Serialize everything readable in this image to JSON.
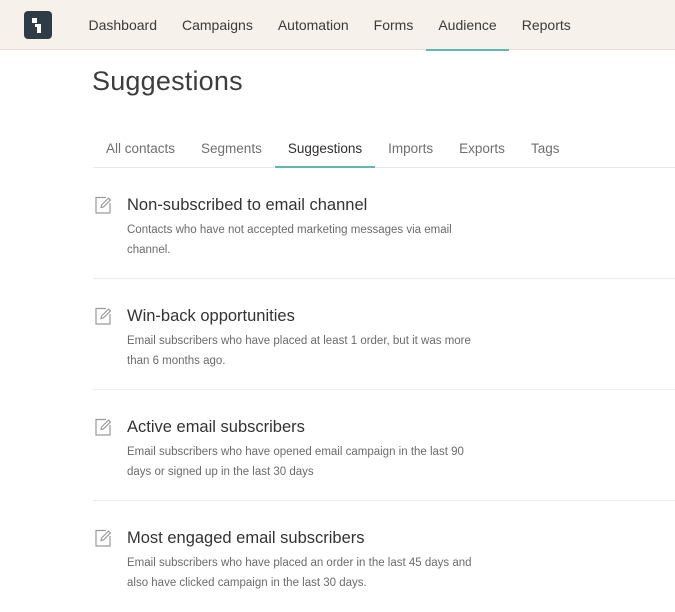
{
  "nav": {
    "items": [
      {
        "label": "Dashboard",
        "active": false
      },
      {
        "label": "Campaigns",
        "active": false
      },
      {
        "label": "Automation",
        "active": false
      },
      {
        "label": "Forms",
        "active": false
      },
      {
        "label": "Audience",
        "active": true
      },
      {
        "label": "Reports",
        "active": false
      }
    ]
  },
  "page": {
    "title": "Suggestions"
  },
  "tabs": [
    {
      "label": "All contacts",
      "active": false
    },
    {
      "label": "Segments",
      "active": false
    },
    {
      "label": "Suggestions",
      "active": true
    },
    {
      "label": "Imports",
      "active": false
    },
    {
      "label": "Exports",
      "active": false
    },
    {
      "label": "Tags",
      "active": false
    }
  ],
  "suggestions": [
    {
      "icon": "edit-icon",
      "title": "Non-subscribed to email channel",
      "description": "Contacts who have not accepted marketing messages via email channel."
    },
    {
      "icon": "edit-icon",
      "title": "Win-back opportunities",
      "description": "Email subscribers who have placed at least 1 order, but it was more than 6 months ago."
    },
    {
      "icon": "edit-icon",
      "title": "Active email subscribers",
      "description": "Email subscribers who have opened email campaign in the last 90 days or signed up in the last 30 days"
    },
    {
      "icon": "edit-icon",
      "title": "Most engaged email subscribers",
      "description": "Email subscribers who have placed an order in the last 45 days and also have clicked campaign in the last 30 days."
    }
  ],
  "colors": {
    "topbar": "#f6f1ea",
    "accent": "#5fb8ae",
    "logo": "#2f3b45"
  }
}
